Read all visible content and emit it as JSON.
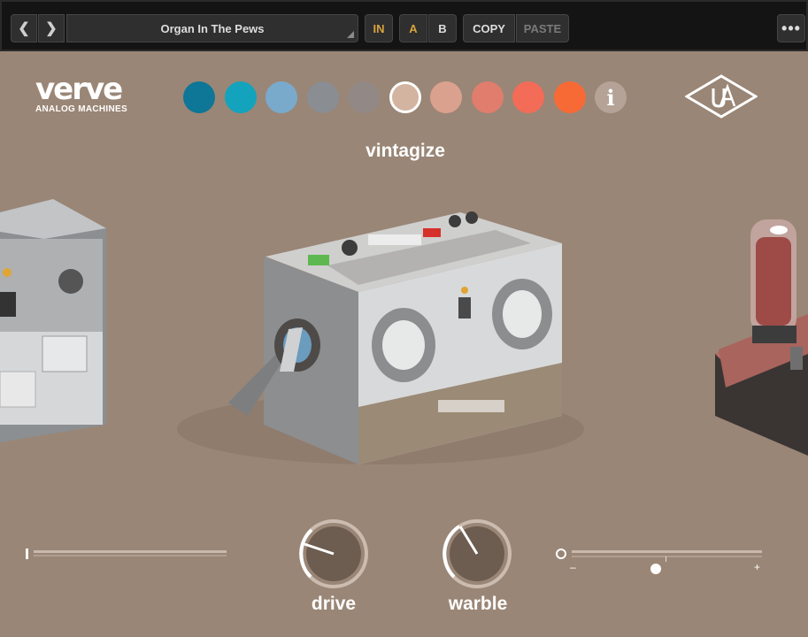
{
  "toolbar": {
    "prev_icon": "chevron-left-icon",
    "next_icon": "chevron-right-icon",
    "preset_name": "Organ In The Pews",
    "in_label": "IN",
    "a_label": "A",
    "b_label": "B",
    "copy_label": "COPY",
    "paste_label": "PASTE",
    "more_icon": "more-icon",
    "active_color": "#d9a23c"
  },
  "header": {
    "logo_word": "verve",
    "logo_sub": "ANALOG MACHINES",
    "brand_logo": "ua-logo",
    "swatches": [
      "#0e7696",
      "#13a3bd",
      "#79aacb",
      "#8a8d92",
      "#928987",
      "#d3b4a0",
      "#dba18f",
      "#e07d6d",
      "#f26c57",
      "#f76a36"
    ],
    "selected_swatch": 5,
    "info_icon": "i"
  },
  "mode_title": "vintagize",
  "controls": {
    "drive_label": "drive",
    "warble_label": "warble"
  }
}
